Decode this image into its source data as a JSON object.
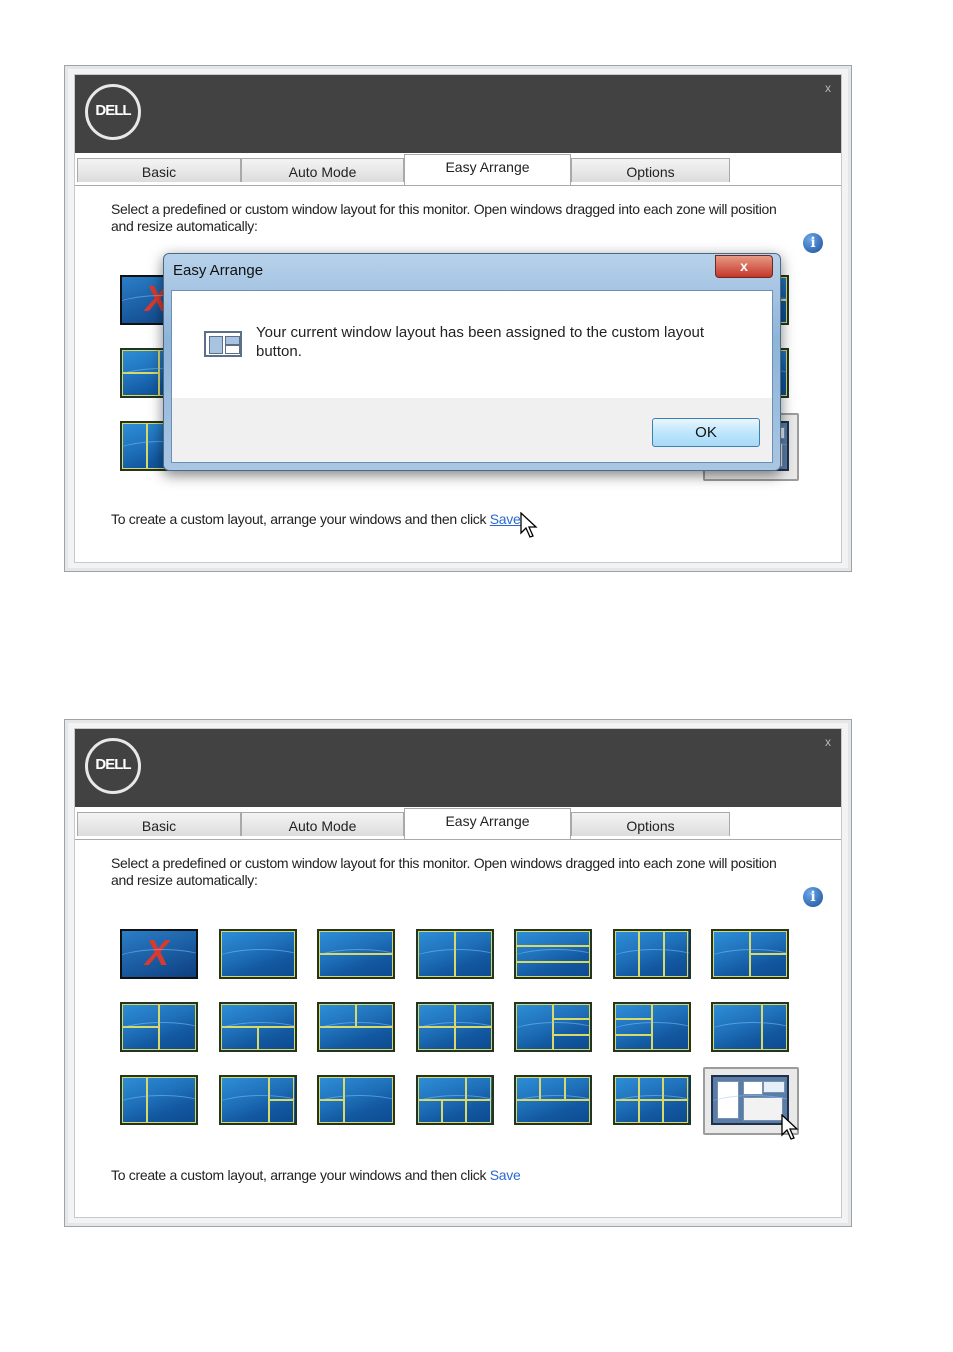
{
  "window": {
    "close_label": "x",
    "logo_text": "DELL",
    "tabs": [
      {
        "label": "Basic"
      },
      {
        "label": "Auto Mode"
      },
      {
        "label": "Easy Arrange"
      },
      {
        "label": "Options"
      }
    ],
    "info_label": "i",
    "description": "Select a predefined or custom window layout for this monitor. Open windows dragged into each zone will position and resize automatically:",
    "footer_text": "To create a custom layout, arrange your windows and then click",
    "footer_link": "Save"
  },
  "dialog": {
    "title": "Easy Arrange",
    "close_label": "x",
    "message": "Your current window layout has been assigned to the custom layout button.",
    "ok_label": "OK"
  },
  "colors": {
    "header": "#424242",
    "link": "#2a6ad0",
    "zone_border": "#d9d96a",
    "no_layout_x": "#d83a2f"
  },
  "layouts": {
    "rows": 3,
    "columns": 7,
    "selected": "custom-layout"
  }
}
